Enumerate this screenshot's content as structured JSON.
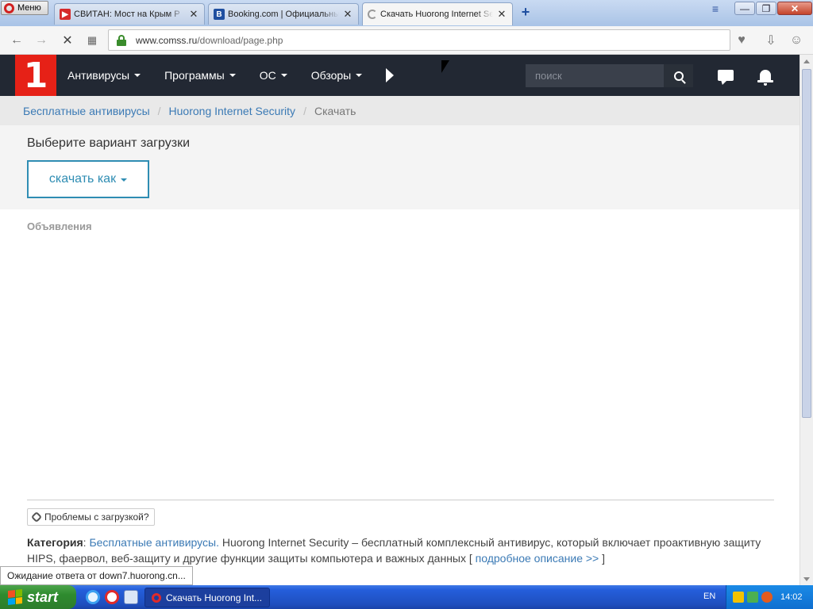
{
  "browser": {
    "menu_label": "Меню",
    "tabs": [
      {
        "title": "СВИТАН: Мост на Крым Р",
        "active": false
      },
      {
        "title": "Booking.com | Официальный",
        "active": false
      },
      {
        "title": "Скачать Huorong Internet Security",
        "active": true
      }
    ],
    "url_domain": "www.comss.ru",
    "url_path": "/download/page.php",
    "status_text": "Ожидание ответа от down7.huorong.cn..."
  },
  "site": {
    "logo_text": "1",
    "nav": [
      {
        "label": "Антивирусы"
      },
      {
        "label": "Программы"
      },
      {
        "label": "ОС"
      },
      {
        "label": "Обзоры"
      }
    ],
    "search_placeholder": "поиск"
  },
  "breadcrumb": {
    "items": [
      "Бесплатные антивирусы",
      "Huorong Internet Security"
    ],
    "current": "Скачать"
  },
  "download": {
    "title": "Выберите вариант загрузки",
    "button_label": "скачать как"
  },
  "ads_label": "Объявления",
  "problems_button": "Проблемы с загрузкой?",
  "category": {
    "label": "Категория",
    "link": "Бесплатные антивирусы.",
    "text": " Huorong Internet Security – бесплатный комплексный антивирус, который включает проактивную защиту HIPS, фаервол, веб-защиту и другие функции защиты компьютера и важных данных [ ",
    "more_link": "подробное описание >>",
    "tail": " ]"
  },
  "taskbar": {
    "start_label": "start",
    "task_label": "Скачать Huorong Int...",
    "lang": "EN",
    "clock": "14:02"
  },
  "colors": {
    "accent": "#2f8db3",
    "header_bg": "#222833",
    "logo_red": "#e62117",
    "link": "#3b7ab5"
  }
}
